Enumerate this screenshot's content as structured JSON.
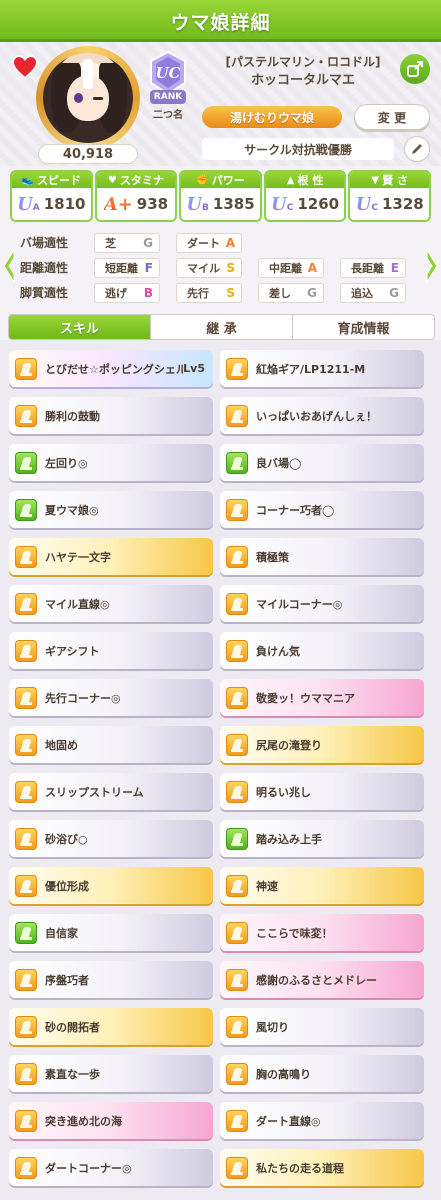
{
  "header": {
    "title": "ウマ娘詳細"
  },
  "profile": {
    "outfit": "[パステルマリン・ロコドル]",
    "name": "ホッコータルマエ",
    "fan_count": "40,918",
    "rank": {
      "grade": "UC",
      "word": "RANK"
    },
    "nickname": "二つ名",
    "title": "湯けむりウマ娘",
    "change_label": "変 更",
    "circle_text": "サークル対抗戦優勝"
  },
  "stats": [
    {
      "label": "スピード",
      "icon": "shoe-icon",
      "grade": "U",
      "grade_sub": "A",
      "value": "1810"
    },
    {
      "label": "スタミナ",
      "icon": "heart-icon",
      "grade": "A+",
      "grade_sub": "",
      "value": "938"
    },
    {
      "label": "パワー",
      "icon": "muscle-icon",
      "grade": "U",
      "grade_sub": "B",
      "value": "1385"
    },
    {
      "label": "根 性",
      "icon": "flame-icon",
      "grade": "U",
      "grade_sub": "C",
      "value": "1260"
    },
    {
      "label": "賢 さ",
      "icon": "cap-icon",
      "grade": "U",
      "grade_sub": "C",
      "value": "1328"
    }
  ],
  "aptitudes": [
    {
      "label": "バ場適性",
      "cells": [
        {
          "name": "芝",
          "grade": "G"
        },
        {
          "name": "ダート",
          "grade": "A"
        }
      ]
    },
    {
      "label": "距離適性",
      "cells": [
        {
          "name": "短距離",
          "grade": "F"
        },
        {
          "name": "マイル",
          "grade": "S"
        },
        {
          "name": "中距離",
          "grade": "A"
        },
        {
          "name": "長距離",
          "grade": "E"
        }
      ]
    },
    {
      "label": "脚質適性",
      "cells": [
        {
          "name": "逃げ",
          "grade": "B"
        },
        {
          "name": "先行",
          "grade": "S"
        },
        {
          "name": "差し",
          "grade": "G"
        },
        {
          "name": "追込",
          "grade": "G"
        }
      ]
    }
  ],
  "tabs": [
    "スキル",
    "継 承",
    "育成情報"
  ],
  "skills": [
    {
      "label": "とびだせ☆ポッピングシェル",
      "extra": "Lv5",
      "style": "rainbow",
      "icon": "gold"
    },
    {
      "label": "紅焔ギア/LP1211-M",
      "extra": "",
      "style": "plain",
      "icon": "gold"
    },
    {
      "label": "勝利の鼓動",
      "extra": "",
      "style": "plain",
      "icon": "gold"
    },
    {
      "label": "いっぱいおあげんしぇ！",
      "extra": "",
      "style": "plain",
      "icon": "gold"
    },
    {
      "label": "左回り◎",
      "extra": "",
      "style": "plain",
      "icon": "green"
    },
    {
      "label": "良バ場◯",
      "extra": "",
      "style": "plain",
      "icon": "green"
    },
    {
      "label": "夏ウマ娘◎",
      "extra": "",
      "style": "plain",
      "icon": "green"
    },
    {
      "label": "コーナー巧者◯",
      "extra": "",
      "style": "plain",
      "icon": "gold"
    },
    {
      "label": "ハヤテ一文字",
      "extra": "",
      "style": "gold",
      "icon": "gold"
    },
    {
      "label": "積極策",
      "extra": "",
      "style": "plain",
      "icon": "gold"
    },
    {
      "label": "マイル直線◎",
      "extra": "",
      "style": "plain",
      "icon": "gold"
    },
    {
      "label": "マイルコーナー◎",
      "extra": "",
      "style": "plain",
      "icon": "gold"
    },
    {
      "label": "ギアシフト",
      "extra": "",
      "style": "plain",
      "icon": "gold"
    },
    {
      "label": "負けん気",
      "extra": "",
      "style": "plain",
      "icon": "gold"
    },
    {
      "label": "先行コーナー◎",
      "extra": "",
      "style": "plain",
      "icon": "gold"
    },
    {
      "label": "敬愛ッ！ウママニア",
      "extra": "",
      "style": "pink",
      "icon": "gold"
    },
    {
      "label": "地固め",
      "extra": "",
      "style": "plain",
      "icon": "gold"
    },
    {
      "label": "尻尾の滝登り",
      "extra": "",
      "style": "gold",
      "icon": "gold"
    },
    {
      "label": "スリップストリーム",
      "extra": "",
      "style": "plain",
      "icon": "gold"
    },
    {
      "label": "明るい兆し",
      "extra": "",
      "style": "plain",
      "icon": "gold"
    },
    {
      "label": "砂浴び○",
      "extra": "",
      "style": "plain",
      "icon": "gold"
    },
    {
      "label": "踏み込み上手",
      "extra": "",
      "style": "plain",
      "icon": "green"
    },
    {
      "label": "優位形成",
      "extra": "",
      "style": "gold",
      "icon": "gold"
    },
    {
      "label": "神速",
      "extra": "",
      "style": "gold",
      "icon": "gold"
    },
    {
      "label": "自信家",
      "extra": "",
      "style": "plain",
      "icon": "green"
    },
    {
      "label": "ここらで味変！",
      "extra": "",
      "style": "pink",
      "icon": "gold"
    },
    {
      "label": "序盤巧者",
      "extra": "",
      "style": "plain",
      "icon": "gold"
    },
    {
      "label": "感謝のふるさとメドレー",
      "extra": "",
      "style": "pink",
      "icon": "gold"
    },
    {
      "label": "砂の開拓者",
      "extra": "",
      "style": "gold",
      "icon": "gold"
    },
    {
      "label": "風切り",
      "extra": "",
      "style": "plain",
      "icon": "gold"
    },
    {
      "label": "素直な一歩",
      "extra": "",
      "style": "plain",
      "icon": "gold"
    },
    {
      "label": "胸の高鳴り",
      "extra": "",
      "style": "plain",
      "icon": "gold"
    },
    {
      "label": "突き進め北の海",
      "extra": "",
      "style": "pink",
      "icon": "gold"
    },
    {
      "label": "ダート直線◎",
      "extra": "",
      "style": "plain",
      "icon": "gold"
    },
    {
      "label": "ダートコーナー◎",
      "extra": "",
      "style": "plain",
      "icon": "gold"
    },
    {
      "label": "私たちの走る道程",
      "extra": "",
      "style": "gold",
      "icon": "gold"
    }
  ],
  "colors": {
    "accent_green": "#7cc126",
    "title_orange": "#ef9a20"
  }
}
